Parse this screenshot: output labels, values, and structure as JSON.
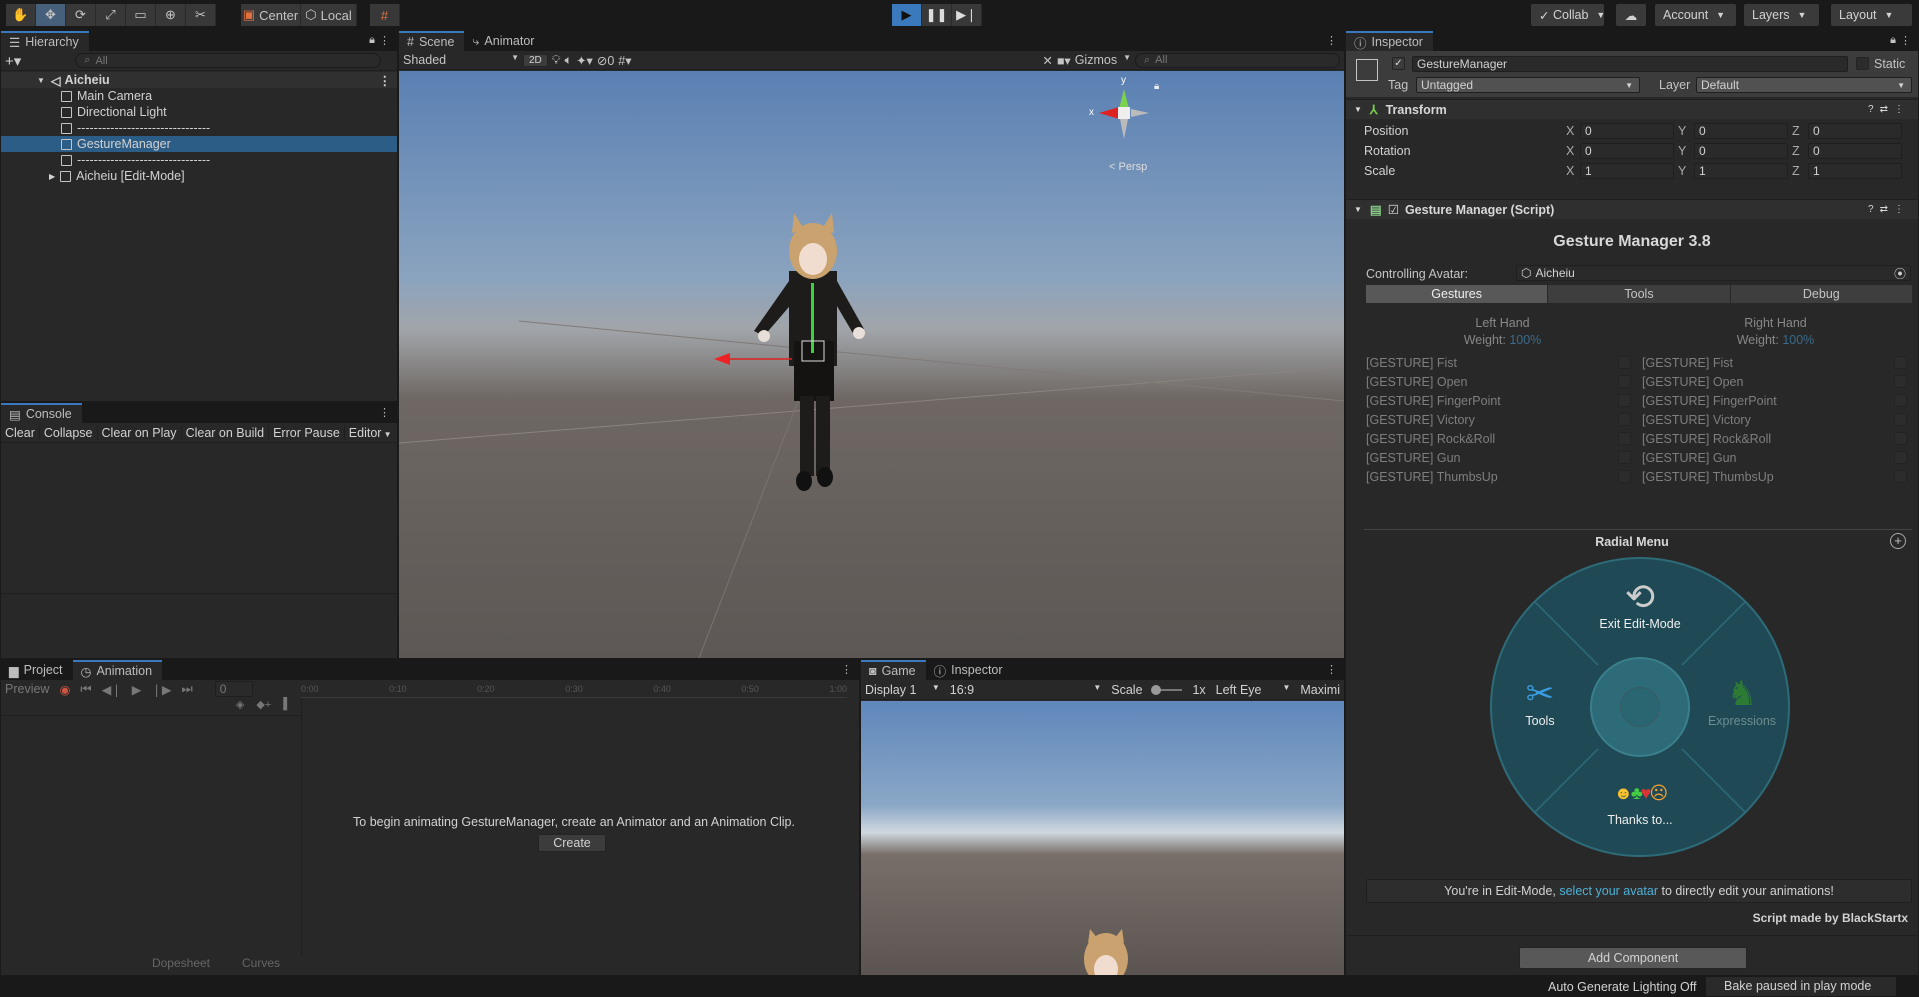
{
  "toolbar": {
    "tools": [
      "hand-tool",
      "move-tool",
      "rotate-tool",
      "scale-tool",
      "rect-tool",
      "transform-tool",
      "custom-tool"
    ],
    "pivot_label": "Center",
    "space_label": "Local",
    "collab_label": "Collab",
    "account_label": "Account",
    "layers_label": "Layers",
    "layout_label": "Layout"
  },
  "hierarchy": {
    "tab_label": "Hierarchy",
    "search_placeholder": "All",
    "scene_name": "Aicheiu",
    "items": [
      {
        "label": "Main Camera"
      },
      {
        "label": "Directional Light"
      },
      {
        "label": "--------------------------------"
      },
      {
        "label": "GestureManager"
      },
      {
        "label": "--------------------------------"
      },
      {
        "label": "Aicheiu [Edit-Mode]"
      }
    ]
  },
  "console": {
    "tab_label": "Console",
    "buttons": [
      "Clear",
      "Collapse",
      "Clear on Play",
      "Clear on Build",
      "Error Pause",
      "Editor"
    ]
  },
  "scene": {
    "tabs": [
      "Scene",
      "Animator"
    ],
    "shading": "Shaded",
    "mode_2d": "2D",
    "hidden_count": "0",
    "gizmos_label": "Gizmos",
    "search_placeholder": "All",
    "gizmo_y": "y",
    "gizmo_x": "x",
    "persp_label": "< Persp"
  },
  "animation": {
    "tabs": [
      "Project",
      "Animation"
    ],
    "preview_label": "Preview",
    "frame_value": "0",
    "ticks": [
      "0:00",
      "0:10",
      "0:20",
      "0:30",
      "0:40",
      "0:50",
      "1:00"
    ],
    "message": "To begin animating GestureManager, create an Animator and an Animation Clip.",
    "create_label": "Create",
    "dopesheet_label": "Dopesheet",
    "curves_label": "Curves"
  },
  "game": {
    "tabs": [
      "Game",
      "Inspector"
    ],
    "display": "Display 1",
    "aspect": "16:9",
    "scale_label": "Scale",
    "scale_value": "1x",
    "eye": "Left Eye",
    "maximize": "Maximi"
  },
  "inspector": {
    "tab_label": "Inspector",
    "object_name": "GestureManager",
    "static_label": "Static",
    "tag_label": "Tag",
    "tag_value": "Untagged",
    "layer_label": "Layer",
    "layer_value": "Default",
    "transform": {
      "title": "Transform",
      "rows": [
        {
          "label": "Position",
          "x": "0",
          "y": "0",
          "z": "0"
        },
        {
          "label": "Rotation",
          "x": "0",
          "y": "0",
          "z": "0"
        },
        {
          "label": "Scale",
          "x": "1",
          "y": "1",
          "z": "1"
        }
      ]
    },
    "script": {
      "title": "Gesture Manager (Script)",
      "heading": "Gesture Manager 3.8",
      "controlling_label": "Controlling Avatar:",
      "controlling_value": "Aicheiu",
      "tabs": [
        "Gestures",
        "Tools",
        "Debug"
      ],
      "left_hand": "Left Hand",
      "right_hand": "Right Hand",
      "weight_label": "Weight:",
      "weight_value": "100%",
      "gestures": [
        "[GESTURE] Fist",
        "[GESTURE] Open",
        "[GESTURE] FingerPoint",
        "[GESTURE] Victory",
        "[GESTURE] Rock&Roll",
        "[GESTURE] Gun",
        "[GESTURE] ThumbsUp"
      ],
      "radial_title": "Radial Menu",
      "radial_items": {
        "top": "Exit Edit-Mode",
        "left": "Tools",
        "right": "Expressions",
        "bottom": "Thanks to..."
      },
      "notice_pre": "You're in Edit-Mode, ",
      "notice_link": "select your avatar",
      "notice_post": " to directly edit your animations!",
      "credit": "Script made by BlackStartx"
    },
    "add_component": "Add Component"
  },
  "status": {
    "lighting": "Auto Generate Lighting Off",
    "bake": "Bake paused in play mode"
  },
  "colors": {
    "accent": "#3a79bb",
    "selection": "#2c5d87",
    "radial": "#1f4a55",
    "link": "#4cb1d6"
  }
}
